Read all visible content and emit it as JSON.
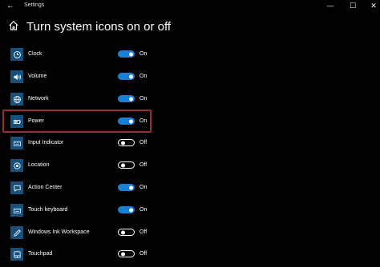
{
  "window": {
    "title": "Settings",
    "back_glyph": "←",
    "controls": {
      "minimize": "—",
      "maximize": "☐",
      "close": "✕"
    }
  },
  "page": {
    "title": "Turn system icons on or off",
    "home_icon": "home-icon"
  },
  "items": [
    {
      "label": "Clock",
      "state": "On",
      "on": true,
      "icon": "clock-icon"
    },
    {
      "label": "Volume",
      "state": "On",
      "on": true,
      "icon": "volume-icon"
    },
    {
      "label": "Network",
      "state": "On",
      "on": true,
      "icon": "network-globe-icon"
    },
    {
      "label": "Power",
      "state": "On",
      "on": true,
      "icon": "battery-icon",
      "highlighted": true
    },
    {
      "label": "Input Indicator",
      "state": "Off",
      "on": false,
      "icon": "keyboard-icon"
    },
    {
      "label": "Location",
      "state": "Off",
      "on": false,
      "icon": "location-icon"
    },
    {
      "label": "Action Center",
      "state": "On",
      "on": true,
      "icon": "action-center-icon"
    },
    {
      "label": "Touch keyboard",
      "state": "On",
      "on": true,
      "icon": "touch-keyboard-icon"
    },
    {
      "label": "Windows Ink Workspace",
      "state": "Off",
      "on": false,
      "icon": "pen-icon"
    },
    {
      "label": "Touchpad",
      "state": "Off",
      "on": false,
      "icon": "touchpad-icon"
    }
  ],
  "colors": {
    "accent": "#1a80d6",
    "tile": "#16507d",
    "highlight": "#9b2a33",
    "background": "#000000"
  }
}
